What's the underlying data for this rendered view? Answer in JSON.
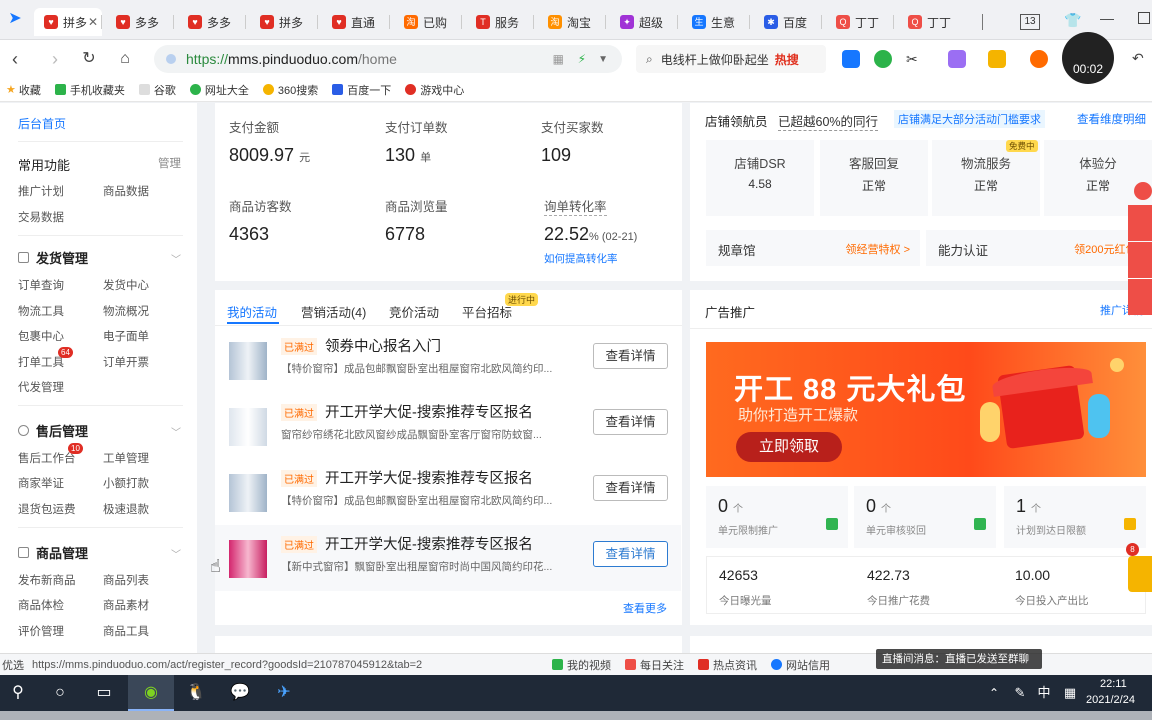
{
  "browser": {
    "tabs": [
      {
        "label": "拼多",
        "color": "#e02e24",
        "icon": "pdd-icon"
      },
      {
        "label": "多多",
        "color": "#e02e24",
        "icon": "pdd-icon"
      },
      {
        "label": "多多",
        "color": "#e02e24",
        "icon": "pdd-icon"
      },
      {
        "label": "拼多",
        "color": "#e02e24",
        "icon": "pdd-icon"
      },
      {
        "label": "直通",
        "color": "#e02e24",
        "icon": "pdd-icon"
      },
      {
        "label": "已购",
        "color": "#ff6a00",
        "icon": "taobao-icon"
      },
      {
        "label": "服务",
        "color": "#e02e24",
        "icon": "tmall-icon"
      },
      {
        "label": "淘宝",
        "color": "#ff9000",
        "icon": "taobao-icon"
      },
      {
        "label": "超级",
        "color": "#a033d6",
        "icon": "star-icon"
      },
      {
        "label": "生意",
        "color": "#1677ff",
        "icon": "shengyi-icon"
      },
      {
        "label": "百度",
        "color": "#2a5de6",
        "icon": "baidu-icon"
      },
      {
        "label": "丁丁",
        "color": "#ee4e47",
        "icon": "q-icon"
      },
      {
        "label": "丁丁",
        "color": "#ee4e47",
        "icon": "q-icon"
      }
    ],
    "tab_count": "13",
    "url_scheme": "https://",
    "url_host": "mms.pinduoduo.com",
    "url_path": "/home",
    "search_text": "电线杆上做仰卧起坐",
    "search_hot": "热搜",
    "recording_time": "00:02"
  },
  "bookmarks": [
    "收藏",
    "手机收藏夹",
    "谷歌",
    "网址大全",
    "360搜索",
    "百度一下",
    "游戏中心"
  ],
  "sidebar": {
    "home": "后台首页",
    "common_title": "常用功能",
    "manage_label": "管理",
    "common_items": [
      "推广计划",
      "商品数据",
      "交易数据"
    ],
    "sections": [
      {
        "title": "发货管理",
        "items": [
          "订单查询",
          "发货中心",
          "物流工具",
          "物流概况",
          "包裹中心",
          "电子面单",
          "打单工具",
          "订单开票",
          "代发管理"
        ],
        "badge": "64"
      },
      {
        "title": "售后管理",
        "items": [
          "售后工作台",
          "工单管理",
          "商家举证",
          "小额打款",
          "退货包运费",
          "极速退款"
        ],
        "badge": "10"
      },
      {
        "title": "商品管理",
        "items": [
          "发布新商品",
          "商品列表",
          "商品体检",
          "商品素材",
          "评价管理",
          "商品工具"
        ]
      }
    ]
  },
  "metrics": [
    {
      "label": "支付金额",
      "value": "8009.97",
      "unit": "元"
    },
    {
      "label": "支付订单数",
      "value": "130",
      "unit": "单"
    },
    {
      "label": "支付买家数",
      "value": "109",
      "unit": ""
    },
    {
      "label": "商品访客数",
      "value": "4363",
      "unit": ""
    },
    {
      "label": "商品浏览量",
      "value": "6778",
      "unit": ""
    },
    {
      "label": "询单转化率",
      "value": "22.52",
      "unit": "% (02-21)"
    }
  ],
  "conversion_link": "如何提高转化率",
  "activities": {
    "tabs": [
      "我的活动",
      "营销活动(4)",
      "竞价活动",
      "平台招标"
    ],
    "hot_badge": "进行中",
    "items": [
      {
        "tag": "已满过",
        "title": "领券中心报名入门",
        "desc": "【特价窗帘】成品包邮飘窗卧室出租屋窗帘北欧风简约印...",
        "btn": "查看详情"
      },
      {
        "tag": "已满过",
        "title": "开工开学大促-搜索推荐专区报名",
        "desc": "窗帘纱帘绣花北欧风窗纱成品飘窗卧室客厅窗帘防蚊窗...",
        "btn": "查看详情"
      },
      {
        "tag": "已满过",
        "title": "开工开学大促-搜索推荐专区报名",
        "desc": "【特价窗帘】成品包邮飘窗卧室出租屋窗帘北欧风简约印...",
        "btn": "查看详情"
      },
      {
        "tag": "已满过",
        "title": "开工开学大促-搜索推荐专区报名",
        "desc": "【新中式窗帘】飘窗卧室出租屋窗帘时尚中国风简约印花...",
        "btn": "查看详情"
      }
    ],
    "more": "查看更多"
  },
  "store": {
    "title": "店铺领航员",
    "rank_text": "已超越60%的同行",
    "hint": "店铺满足大部分活动门槛要求",
    "dimension_link": "查看维度明细",
    "boxes": [
      {
        "label": "店铺DSR",
        "value": "4.58"
      },
      {
        "label": "客服回复",
        "value": "正常"
      },
      {
        "label": "物流服务",
        "value": "正常",
        "badge": "免费中"
      },
      {
        "label": "体验分",
        "value": "正常"
      }
    ],
    "links": [
      {
        "label": "规章馆",
        "action": "领经营特权 >"
      },
      {
        "label": "能力认证",
        "action": "领200元红包 >"
      }
    ]
  },
  "ads": {
    "title": "广告推广",
    "link": "推广详情",
    "banner_title": "开工 88 元大礼包",
    "banner_sub": "助你打造开工爆款",
    "banner_btn": "立即领取",
    "stats": [
      {
        "value": "0",
        "unit": "个",
        "label": "单元限制推广"
      },
      {
        "value": "0",
        "unit": "个",
        "label": "单元审核驳回"
      },
      {
        "value": "1",
        "unit": "个",
        "label": "计划到达日限额"
      }
    ],
    "today": [
      {
        "value": "42653",
        "label": "今日曝光量"
      },
      {
        "value": "422.73",
        "label": "今日推广花费"
      },
      {
        "value": "10.00",
        "label": "今日投入产出比"
      }
    ]
  },
  "statusbar": {
    "prefix": "优选",
    "url": "https://mms.pinduoduo.com/act/register_record?goodsId=210787045912&tab=2",
    "items": [
      "我的视频",
      "每日关注",
      "热点资讯",
      "网站信用"
    ],
    "toast": "直播间消息：直播已发送至群聊",
    "float_badge": "8"
  },
  "taskbar": {
    "ime": "中",
    "time": "22:11",
    "date": "2021/2/24"
  },
  "colors": {
    "brand": "#e02e24",
    "accent": "#1677ff",
    "banner": "#ff5a1f"
  }
}
